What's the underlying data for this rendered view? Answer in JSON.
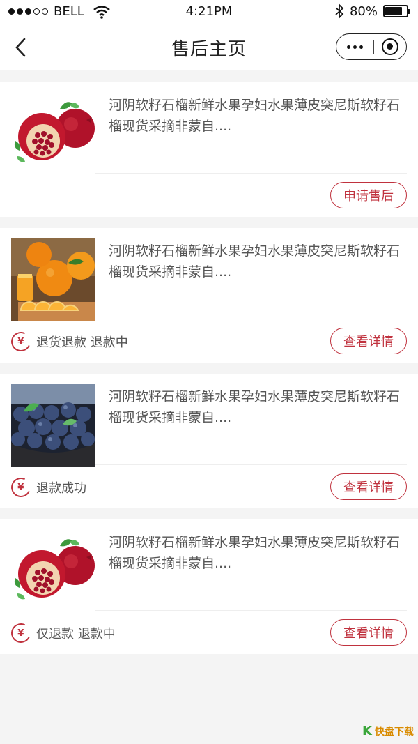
{
  "status_bar": {
    "carrier": "BELL",
    "time": "4:21PM",
    "battery": "80%",
    "battery_level": 0.8,
    "signal_dots": 5,
    "signal_filled": 3
  },
  "nav": {
    "title": "售后主页"
  },
  "orders": [
    {
      "title": "河阴软籽石榴新鲜水果孕妇水果薄皮突尼斯软籽石榴现货采摘非蒙自....",
      "image": "pomegranate",
      "status": "",
      "button": "申请售后"
    },
    {
      "title": "河阴软籽石榴新鲜水果孕妇水果薄皮突尼斯软籽石榴现货采摘非蒙自....",
      "image": "oranges",
      "status": "退货退款 退款中",
      "button": "查看详情"
    },
    {
      "title": "河阴软籽石榴新鲜水果孕妇水果薄皮突尼斯软籽石榴现货采摘非蒙自....",
      "image": "blueberries",
      "status": "退款成功",
      "button": "查看详情"
    },
    {
      "title": "河阴软籽石榴新鲜水果孕妇水果薄皮突尼斯软籽石榴现货采摘非蒙自....",
      "image": "pomegranate",
      "status": "仅退款 退款中",
      "button": "查看详情"
    }
  ],
  "icons": {
    "refund": "¥",
    "watermark_k": "K",
    "watermark": "快盘下载"
  },
  "colors": {
    "accent": "#c0323e",
    "background": "#f4f4f4"
  }
}
